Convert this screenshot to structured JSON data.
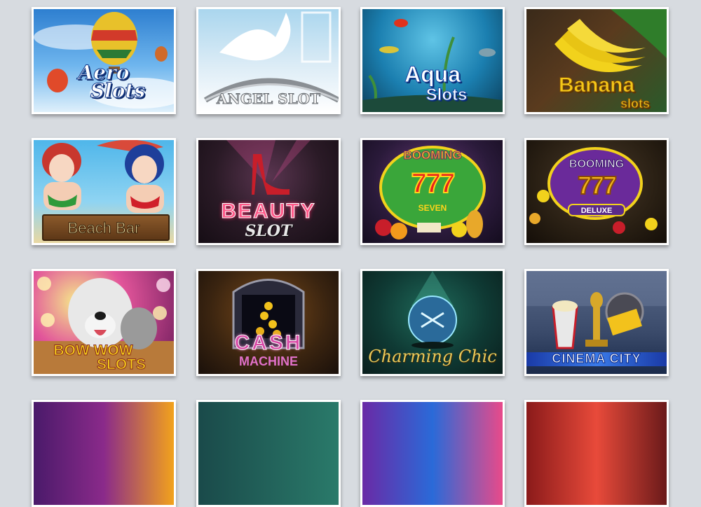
{
  "games": [
    {
      "title_line1": "Aero",
      "title_line2": "Slots"
    },
    {
      "title_line1": "ANGEL SLOT"
    },
    {
      "title_line1": "Aqua",
      "title_line2": "Slots"
    },
    {
      "title_line1": "Banana",
      "title_line2": "slots"
    },
    {
      "title_line1": "Beach Bar"
    },
    {
      "title_line1": "BEAUTY",
      "title_line2": "SLOT"
    },
    {
      "title_line1": "BOOMING",
      "title_line2": "SEVEN",
      "digits": "777"
    },
    {
      "title_line1": "BOOMING",
      "title_line2": "DELUXE",
      "digits": "777"
    },
    {
      "title_line1": "BOW WOW",
      "title_line2": "SLOTS"
    },
    {
      "title_line1": "CASH",
      "title_line2": "MACHINE"
    },
    {
      "title_line1": "Charming Chic"
    },
    {
      "title_line1": "CINEMA CITY"
    }
  ]
}
